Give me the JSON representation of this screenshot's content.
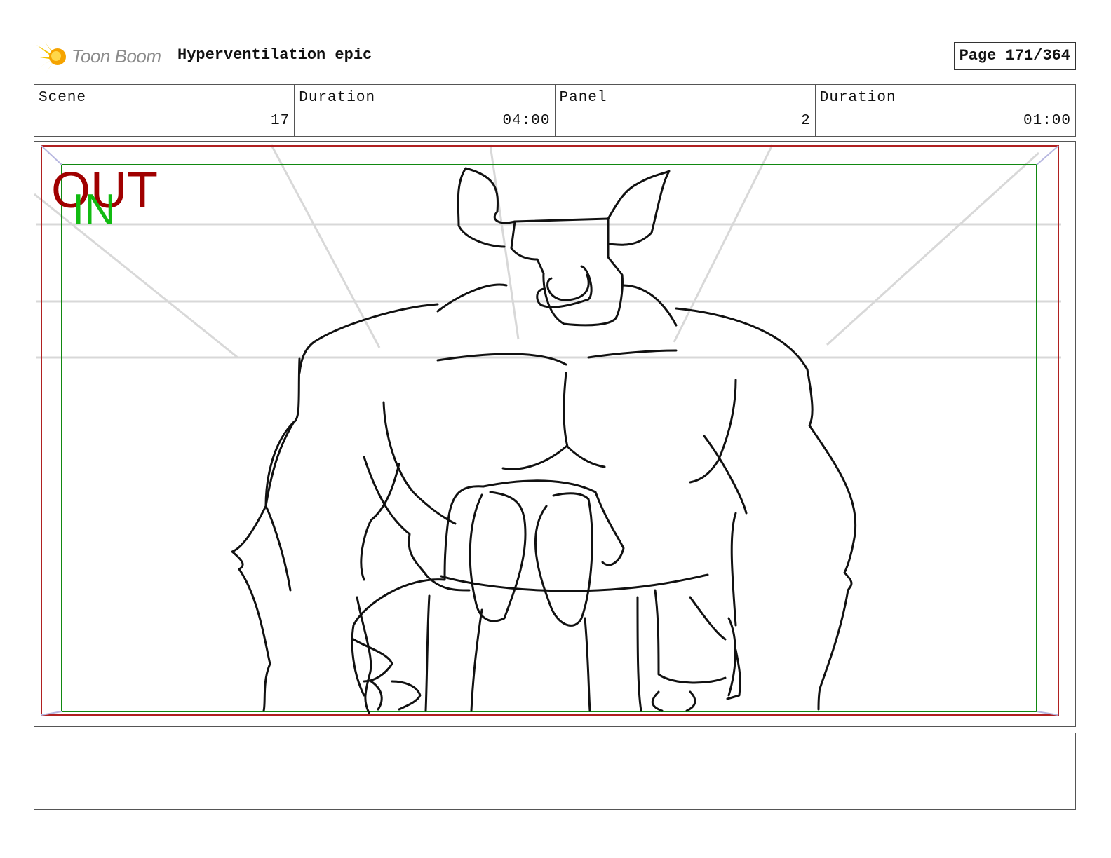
{
  "header": {
    "logo_text": "Toon Boom",
    "title": "Hyperventilation epic",
    "page": "Page 171/364"
  },
  "info": {
    "scene_label": "Scene",
    "scene_value": "17",
    "scene_duration_label": "Duration",
    "scene_duration_value": "04:00",
    "panel_label": "Panel",
    "panel_value": "2",
    "panel_duration_label": "Duration",
    "panel_duration_value": "01:00"
  },
  "frame": {
    "out_label": "OUT",
    "in_label": "IN",
    "out_color": "#a00000",
    "in_color": "#11bb11"
  },
  "notes": {
    "text": ""
  }
}
